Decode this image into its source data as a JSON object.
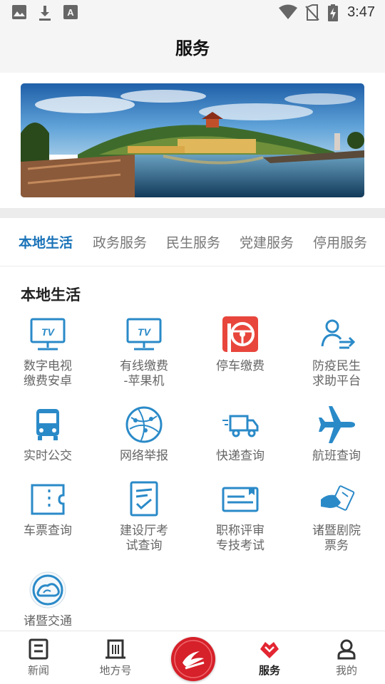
{
  "status_bar": {
    "time": "3:47",
    "left_icons": [
      "image-icon",
      "download-icon",
      "font-icon"
    ],
    "right_icons": [
      "wifi-icon",
      "no-sim-icon",
      "battery-charging-icon"
    ]
  },
  "header": {
    "title": "服务"
  },
  "banner": {
    "image": "landscape-lake-pavilion"
  },
  "tabs": [
    {
      "label": "本地生活",
      "active": true
    },
    {
      "label": "政务服务",
      "active": false
    },
    {
      "label": "民生服务",
      "active": false
    },
    {
      "label": "党建服务",
      "active": false
    },
    {
      "label": "停用服务",
      "active": false
    }
  ],
  "section": {
    "title": "本地生活",
    "items": [
      {
        "label": "数字电视\n缴费安卓",
        "icon": "tv-icon"
      },
      {
        "label": "有线缴费\n-苹果机",
        "icon": "tv-icon"
      },
      {
        "label": "停车缴费",
        "icon": "parking-icon"
      },
      {
        "label": "防疫民生\n求助平台",
        "icon": "person-arrow-icon"
      },
      {
        "label": "实时公交",
        "icon": "bus-icon"
      },
      {
        "label": "网络举报",
        "icon": "network-globe-icon"
      },
      {
        "label": "快递查询",
        "icon": "delivery-truck-icon"
      },
      {
        "label": "航班查询",
        "icon": "airplane-icon"
      },
      {
        "label": "车票查询",
        "icon": "ticket-icon"
      },
      {
        "label": "建设厅考\n试查询",
        "icon": "exam-document-icon"
      },
      {
        "label": "职称评审\n专技考试",
        "icon": "certificate-card-icon"
      },
      {
        "label": "诸暨剧院\n票务",
        "icon": "theater-tickets-icon"
      },
      {
        "label": "诸暨交通",
        "icon": "traffic-logo-icon"
      }
    ]
  },
  "bottom_nav": [
    {
      "label": "新闻",
      "icon": "news-icon",
      "active": false
    },
    {
      "label": "地方号",
      "icon": "building-icon",
      "active": false
    },
    {
      "label": "",
      "icon": "home-logo-icon",
      "active": false
    },
    {
      "label": "服务",
      "icon": "heart-diamond-icon",
      "active": true
    },
    {
      "label": "我的",
      "icon": "profile-icon",
      "active": false
    }
  ],
  "colors": {
    "accent": "#1a73b8",
    "icon_blue": "#2a8ac8",
    "brand_red": "#d6202a"
  }
}
